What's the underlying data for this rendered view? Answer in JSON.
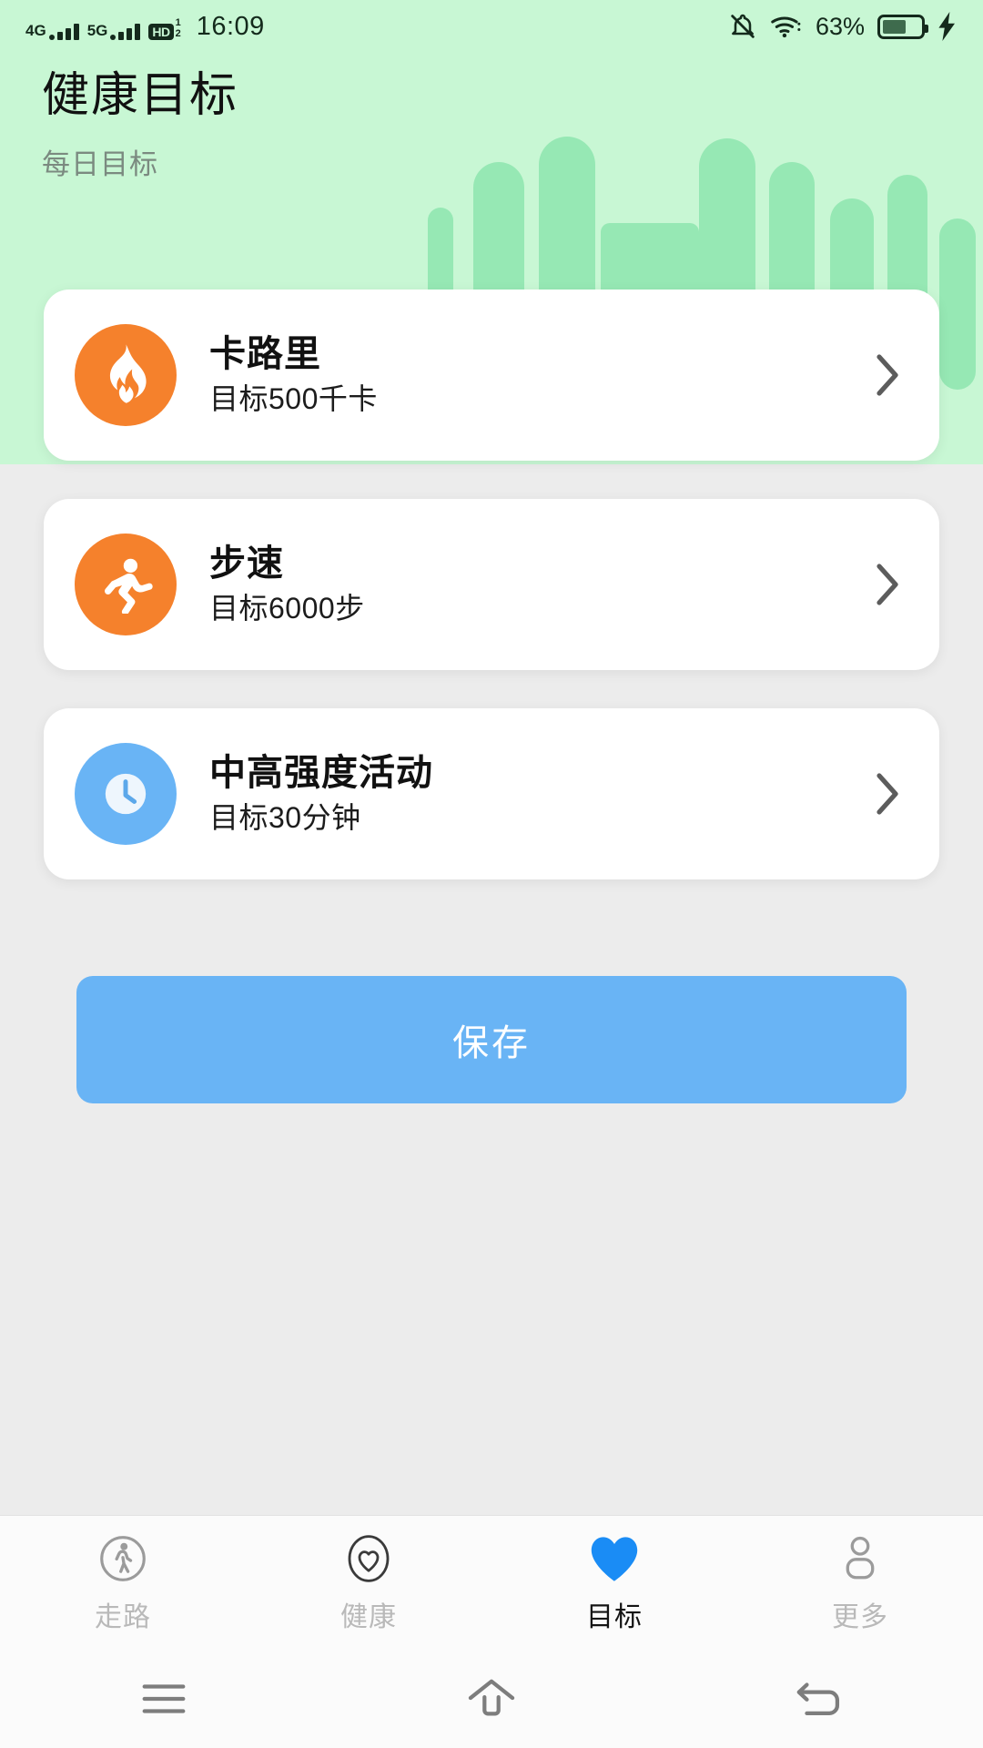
{
  "status_bar": {
    "network_4g": "4G",
    "network_5g": "5G",
    "hd_badge": "HD",
    "hd_sub_top": "1",
    "hd_sub_bottom": "2",
    "time": "16:09",
    "battery_percent": "63%",
    "battery_level": 63,
    "icons": [
      "bell-muted-icon",
      "wifi-icon",
      "battery-icon",
      "charging-bolt-icon"
    ]
  },
  "header": {
    "title": "健康目标",
    "subtitle": "每日目标",
    "background_color": "#c8f7d4",
    "decoration_color": "#96e8b4"
  },
  "goals": [
    {
      "title": "卡路里",
      "subtitle": "目标500千卡",
      "icon": "flame-icon",
      "icon_bg": "#f5812c",
      "chevron": "chevron-right-icon"
    },
    {
      "title": "步速",
      "subtitle": "目标6000步",
      "icon": "running-person-icon",
      "icon_bg": "#f5812c",
      "chevron": "chevron-right-icon"
    },
    {
      "title": "中高强度活动",
      "subtitle": "目标30分钟",
      "icon": "clock-icon",
      "icon_bg": "#69b4f5",
      "chevron": "chevron-right-icon"
    }
  ],
  "save_button": {
    "label": "保存",
    "color": "#69b4f5"
  },
  "tabbar": {
    "active_color": "#1a8cf5",
    "items": [
      {
        "label": "走路",
        "icon": "walking-person-circle-icon",
        "active": false
      },
      {
        "label": "健康",
        "icon": "heart-outline-icon",
        "active": false
      },
      {
        "label": "目标",
        "icon": "heart-filled-icon",
        "active": true
      },
      {
        "label": "更多",
        "icon": "person-icon",
        "active": false
      }
    ]
  },
  "system_nav": {
    "items": [
      {
        "icon": "recents-menu-icon"
      },
      {
        "icon": "home-icon"
      },
      {
        "icon": "back-icon"
      }
    ]
  }
}
